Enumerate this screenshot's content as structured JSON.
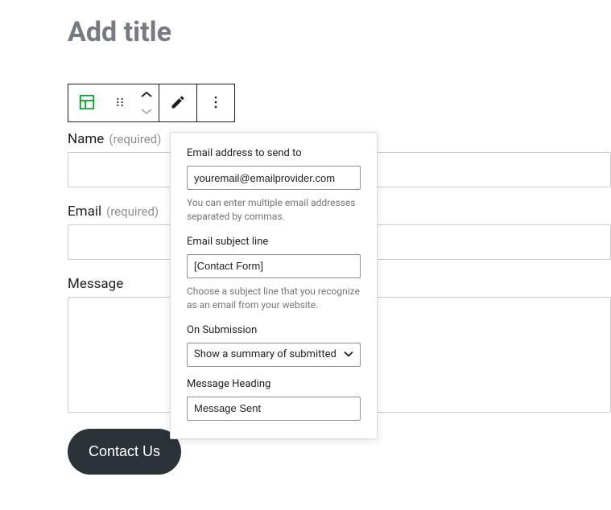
{
  "page": {
    "title_placeholder": "Add title"
  },
  "form": {
    "name": {
      "label": "Name",
      "required_text": "(required)",
      "value": ""
    },
    "email": {
      "label": "Email",
      "required_text": "(required)",
      "value": ""
    },
    "message": {
      "label": "Message",
      "value": ""
    },
    "submit_label": "Contact Us"
  },
  "popover": {
    "send_to_label": "Email address to send to",
    "send_to_value": "youremail@emailprovider.com",
    "send_to_help": "You can enter multiple email addresses separated by commas.",
    "subject_label": "Email subject line",
    "subject_value": "[Contact Form]",
    "subject_help": "Choose a subject line that you recognize as an email from your website.",
    "on_submission_label": "On Submission",
    "on_submission_value": "Show a summary of submitted",
    "message_heading_label": "Message Heading",
    "message_heading_value": "Message Sent"
  }
}
